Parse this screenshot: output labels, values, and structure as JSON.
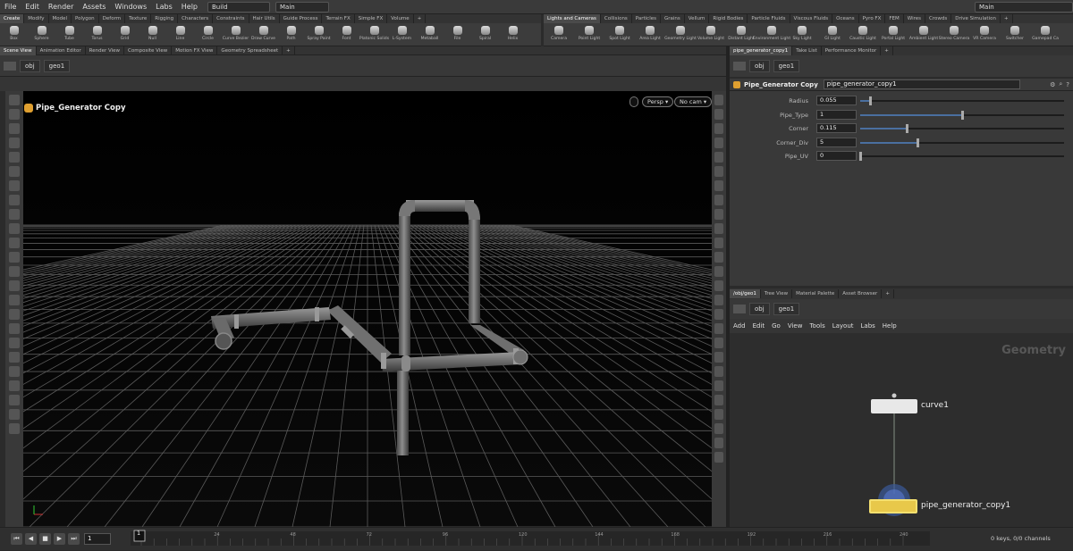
{
  "menubar": {
    "items": [
      "File",
      "Edit",
      "Render",
      "Assets",
      "Windows",
      "Labs",
      "Help"
    ],
    "desktop": "Build",
    "context": "Main",
    "right_context": "Main"
  },
  "shelf_left": {
    "tabs": [
      "Create",
      "Modify",
      "Model",
      "Polygon",
      "Deform",
      "Texture",
      "Rigging",
      "Characters",
      "Constraints",
      "Hair Utils",
      "Guide Process",
      "Terrain FX",
      "Simple FX",
      "Volume"
    ],
    "tools": [
      "Box",
      "Sphere",
      "Tube",
      "Torus",
      "Grid",
      "Null",
      "Line",
      "Circle",
      "Curve Bezier",
      "Draw Curve",
      "Path",
      "Spray Paint",
      "Font",
      "Platonic Solids",
      "L-System",
      "Metaball",
      "File",
      "Spiral",
      "Helix"
    ]
  },
  "shelf_right": {
    "tabs": [
      "Lights and Cameras",
      "Collisions",
      "Particles",
      "Grains",
      "Vellum",
      "Rigid Bodies",
      "Particle Fluids",
      "Viscous Fluids",
      "Oceans",
      "Pyro FX",
      "FEM",
      "Wires",
      "Crowds",
      "Drive Simulation"
    ],
    "tools": [
      "Camera",
      "Point Light",
      "Spot Light",
      "Area Light",
      "Geometry Light",
      "Volume Light",
      "Distant Light",
      "Environment Light",
      "Sky Light",
      "GI Light",
      "Caustic Light",
      "Portal Light",
      "Ambient Light",
      "Stereo Camera",
      "VR Camera",
      "Switcher",
      "Gamepad Ca"
    ]
  },
  "viewport_tabs": [
    "Scene View",
    "Animation Editor",
    "Render View",
    "Composite View",
    "Motion FX View",
    "Geometry Spreadsheet"
  ],
  "param_tabs": [
    "pipe_generator_copy1",
    "Take List",
    "Performance Monitor"
  ],
  "path_left": {
    "obj": "obj",
    "geo": "geo1"
  },
  "path_right": {
    "obj": "obj",
    "geo": "geo1"
  },
  "viewport": {
    "title": "Pipe_Generator Copy",
    "persp": "Persp",
    "cam": "No cam"
  },
  "params": {
    "node_type": "Pipe_Generator Copy",
    "node_name": "pipe_generator_copy1",
    "rows": [
      {
        "label": "Radius",
        "value": "0.055",
        "level": 0.05
      },
      {
        "label": "Pipe_Type",
        "value": "1",
        "level": 0.5
      },
      {
        "label": "Corner",
        "value": "0.115",
        "level": 0.23
      },
      {
        "label": "Corner_Div",
        "value": "5",
        "level": 0.28
      },
      {
        "label": "Pipe_UV",
        "value": "0",
        "level": 0.0
      }
    ]
  },
  "network_tabs": [
    "/obj/geo1",
    "Tree View",
    "Material Palette",
    "Asset Browser"
  ],
  "network_menu": [
    "Add",
    "Edit",
    "Go",
    "View",
    "Tools",
    "Layout",
    "Labs",
    "Help"
  ],
  "network": {
    "label": "Geometry",
    "nodes": [
      {
        "name": "curve1"
      },
      {
        "name": "pipe_generator_copy1"
      }
    ]
  },
  "timeline": {
    "frame": "1",
    "start_marker": "1",
    "ticks": [
      "24",
      "48",
      "72",
      "96",
      "120",
      "144",
      "168",
      "192",
      "216",
      "240"
    ],
    "keys_label": "0 keys, 0/0 channels"
  },
  "colors": {
    "accent": "#e0a030",
    "slider_fill": "#4a6fa0",
    "node_selected": "#e8c84a"
  }
}
